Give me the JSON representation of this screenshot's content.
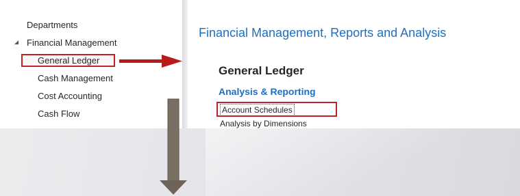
{
  "nav": {
    "items": [
      {
        "label": "Departments"
      },
      {
        "label": "Financial Management"
      },
      {
        "label": "General Ledger"
      },
      {
        "label": "Cash Management"
      },
      {
        "label": "Cost Accounting"
      },
      {
        "label": "Cash Flow"
      }
    ],
    "selected": "General Ledger"
  },
  "main": {
    "page_title": "Financial Management, Reports and Analysis",
    "section_title": "General Ledger",
    "subsection_title": "Analysis & Reporting",
    "links": [
      {
        "label": "Account Schedules"
      },
      {
        "label": "Analysis by Dimensions"
      }
    ]
  },
  "colors": {
    "accent_blue": "#1e6fbf",
    "highlight_red": "#c01f26",
    "arrow_red": "#b71c1c",
    "arrow_gray": "#7a6f63"
  },
  "icons": {
    "collapse": "expanded-triangle-icon",
    "right_arrow": "red-arrow-right-icon",
    "down_arrow": "gray-arrow-down-icon"
  }
}
